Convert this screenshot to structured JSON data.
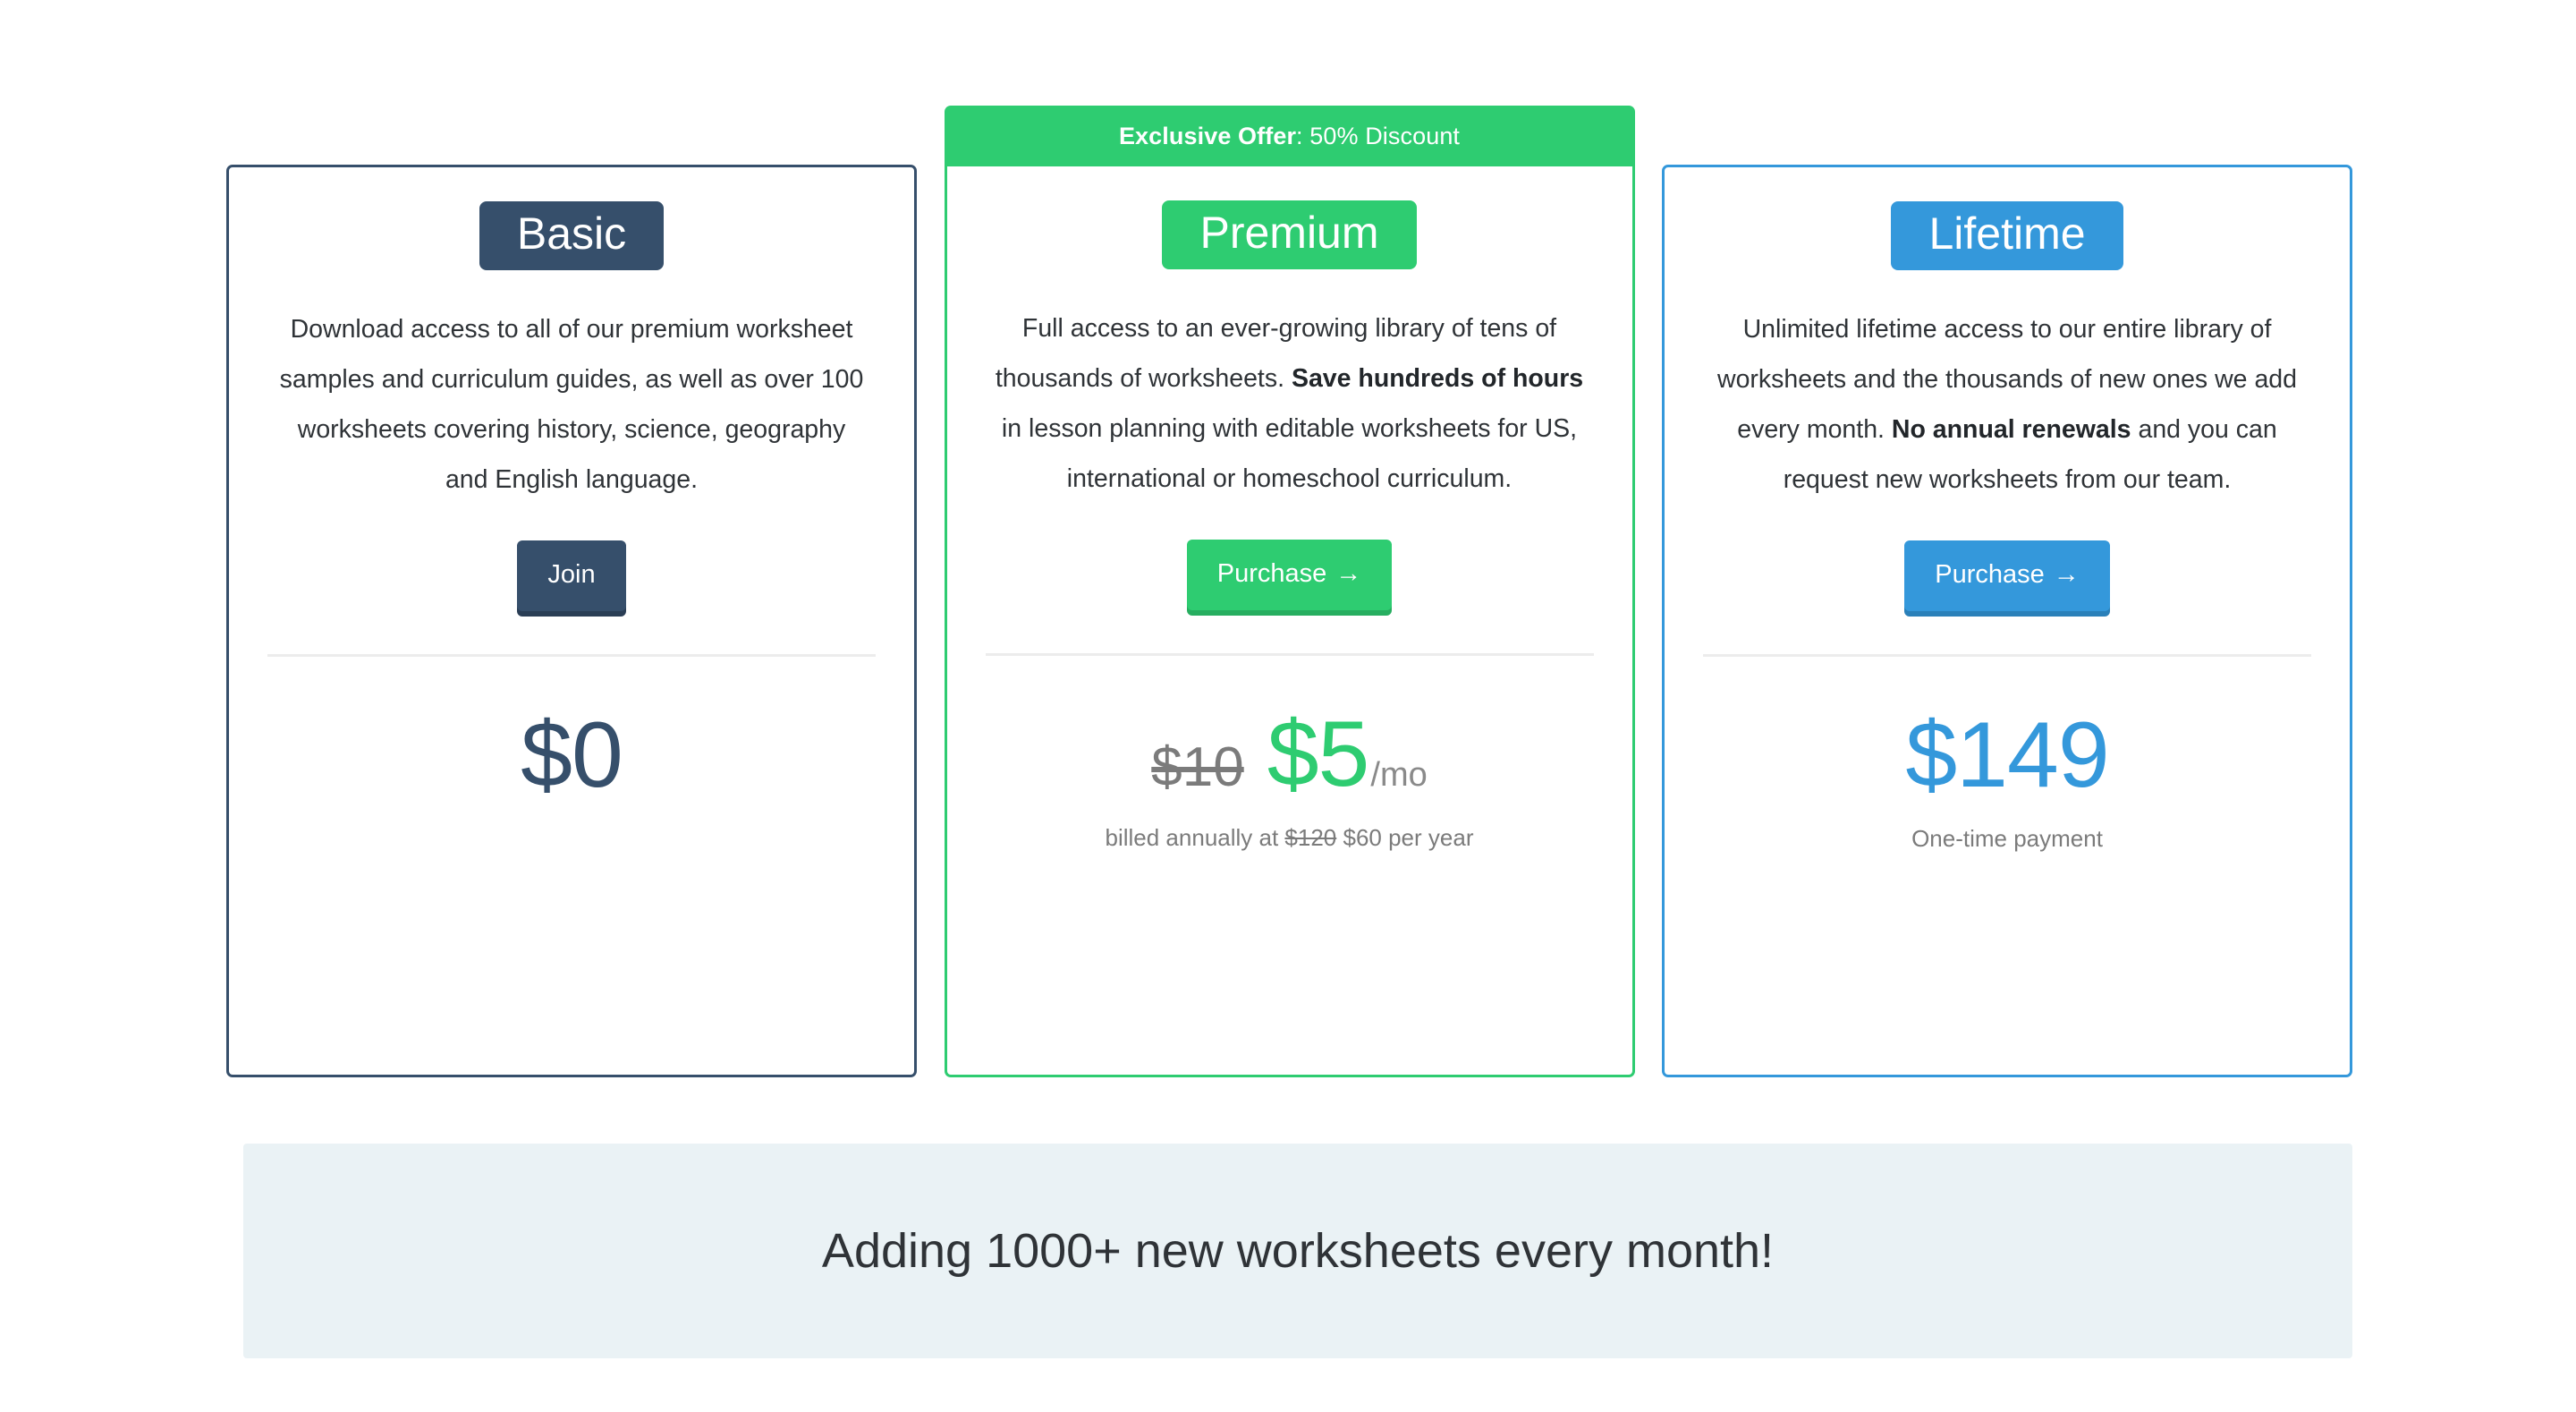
{
  "plans": [
    {
      "id": "basic",
      "name": "Basic",
      "accent": "#364f6b",
      "description_parts": [
        {
          "text": "Download access to all of our premium worksheet samples and curriculum guides, as well as over 100 worksheets covering history, science, geography and English language.",
          "bold": false
        }
      ],
      "cta_label": "Join",
      "cta_has_arrow": false,
      "price": "$0",
      "price_old": "",
      "price_period": "",
      "price_note": "",
      "promo_banner": null
    },
    {
      "id": "premium",
      "name": "Premium",
      "accent": "#2ecc71",
      "description_parts": [
        {
          "text": "Full access to an ever-growing library of tens of thousands of worksheets. ",
          "bold": false
        },
        {
          "text": "Save hundreds of hours",
          "bold": true
        },
        {
          "text": " in lesson planning with editable worksheets for US, international or homeschool curriculum.",
          "bold": false
        }
      ],
      "cta_label": "Purchase",
      "cta_arrow": "→",
      "cta_has_arrow": true,
      "price": "$5",
      "price_old": "$10",
      "price_period": "/mo",
      "price_note_prefix": "billed annually at ",
      "price_note_struck": "$120",
      "price_note_suffix": " $60 per year",
      "promo_banner": {
        "strong": "Exclusive Offer",
        "rest": ": 50% Discount"
      }
    },
    {
      "id": "lifetime",
      "name": "Lifetime",
      "accent": "#3498db",
      "description_parts": [
        {
          "text": "Unlimited lifetime access to our entire library of worksheets and the thousands of new ones we add every month. ",
          "bold": false
        },
        {
          "text": "No annual renewals",
          "bold": true
        },
        {
          "text": " and you can request new worksheets from our team.",
          "bold": false
        }
      ],
      "cta_label": "Purchase",
      "cta_arrow": "→",
      "cta_has_arrow": true,
      "price": "$149",
      "price_old": "",
      "price_period": "",
      "price_note": "One-time payment",
      "promo_banner": null
    }
  ],
  "bottom_banner": {
    "text": "Adding 1000+ new worksheets every month!",
    "background": "#eaf2f5"
  }
}
